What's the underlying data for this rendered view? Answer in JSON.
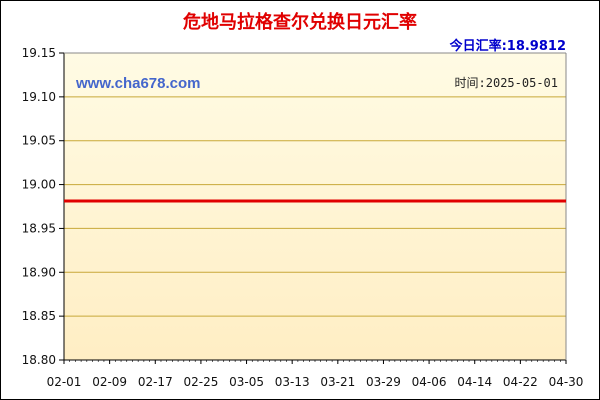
{
  "chart_data": {
    "type": "line",
    "title": "危地马拉格查尔兑换日元汇率",
    "rate_label": "今日汇率:18.9812",
    "watermark": "www.cha678.com",
    "date_label": "时间:2025-05-01",
    "x_ticks": [
      "02-01",
      "02-09",
      "02-17",
      "02-25",
      "03-05",
      "03-13",
      "03-21",
      "03-29",
      "04-06",
      "04-14",
      "04-22",
      "04-30"
    ],
    "y_ticks": [
      "19.15",
      "19.10",
      "19.05",
      "19.00",
      "18.95",
      "18.90",
      "18.85",
      "18.80"
    ],
    "ylim": [
      18.8,
      19.15
    ],
    "xlim": [
      "2025-02-01",
      "2025-04-30"
    ],
    "series": [
      {
        "x": [
          "2025-02-01",
          "2025-04-30"
        ],
        "values": [
          18.9812,
          18.9812
        ]
      }
    ],
    "grid": true,
    "colors": {
      "line": "#e00000",
      "title": "#e00000",
      "rate": "#0000cc",
      "watermark": "#4466cc"
    }
  }
}
